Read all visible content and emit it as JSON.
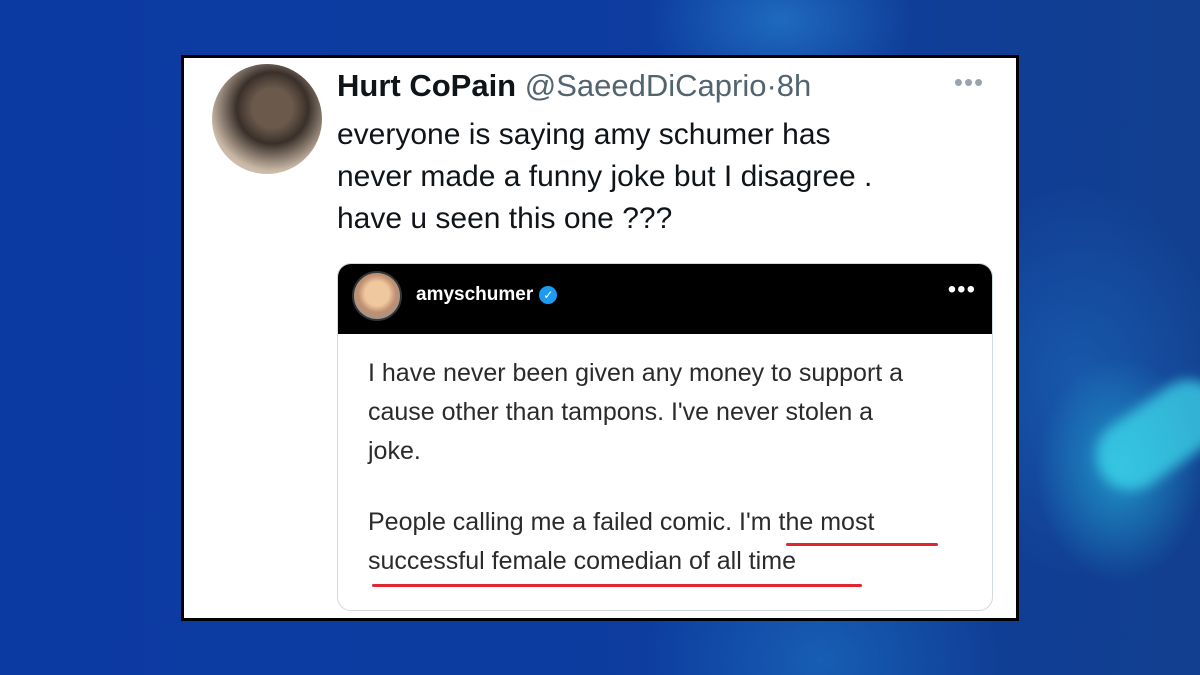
{
  "tweet": {
    "display_name": "Hurt CoPain",
    "handle": "@SaeedDiCaprio",
    "separator": "·",
    "time": "8h",
    "more_label": "•••",
    "text_lines": [
      "everyone is saying amy schumer has",
      "never made a funny joke but I disagree .",
      "have u seen this one ???"
    ]
  },
  "embedded_post": {
    "username": "amyschumer",
    "verified_mark": "✓",
    "more_label": "•••",
    "paragraph1_lines": [
      "I have never been given any money to support a",
      "cause other than tampons. I've never stolen a",
      "joke."
    ],
    "paragraph2_lines": [
      "People calling me a failed comic. I'm the most",
      "successful female comedian of all time"
    ],
    "highlight_color": "#e0262e"
  },
  "colors": {
    "background": "#0b3aa3",
    "accent_cyan": "#3cd7eb",
    "verified_blue": "#1d9bf0"
  }
}
